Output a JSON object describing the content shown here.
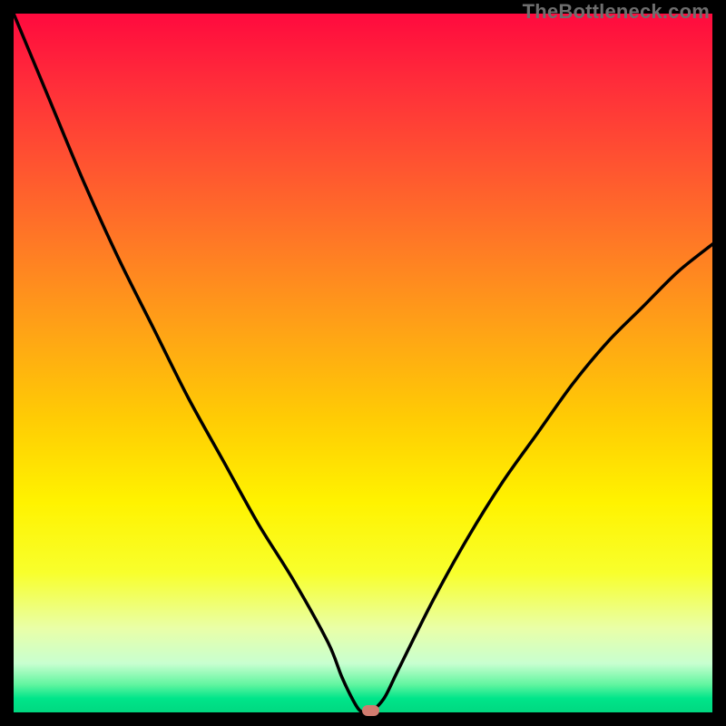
{
  "attribution": "TheBottleneck.com",
  "colors": {
    "frame": "#000000",
    "gradient_top": "#ff0a3e",
    "gradient_bottom": "#00d880",
    "curve": "#000000",
    "marker": "#d17b6f"
  },
  "chart_data": {
    "type": "line",
    "title": "",
    "xlabel": "",
    "ylabel": "",
    "xlim": [
      0,
      100
    ],
    "ylim": [
      0,
      100
    ],
    "grid": false,
    "series": [
      {
        "name": "bottleneck-curve",
        "x": [
          0,
          5,
          10,
          15,
          20,
          25,
          30,
          35,
          40,
          45,
          47,
          49,
          50,
          51,
          53,
          55,
          60,
          65,
          70,
          75,
          80,
          85,
          90,
          95,
          100
        ],
        "values": [
          100,
          88,
          76,
          65,
          55,
          45,
          36,
          27,
          19,
          10,
          5,
          1,
          0,
          0,
          2,
          6,
          16,
          25,
          33,
          40,
          47,
          53,
          58,
          63,
          67
        ]
      }
    ],
    "marker": {
      "x": 51,
      "y": 0
    }
  }
}
